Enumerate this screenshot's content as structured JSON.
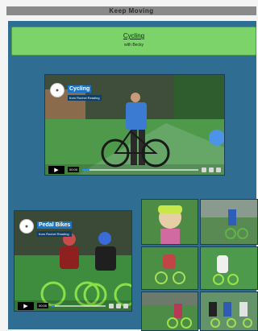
{
  "header": {
    "title": "Keep Moving"
  },
  "banner": {
    "title": "Cycling",
    "subtitle": "with Becky"
  },
  "video_main": {
    "title": "Cycling",
    "subtitle": "from Rochel Reading",
    "time": "00:00"
  },
  "video_pedal": {
    "title": "Pedal Bikes",
    "subtitle": "from Rochel Reading",
    "time": "00:00"
  },
  "colors": {
    "page_bg": "#2f6d93",
    "banner_bg": "#7bd36a",
    "topbar_bg": "#8a8a8a",
    "video_title_bg": "#1b74c6"
  },
  "thumbnails": [
    {
      "name": "photo-1"
    },
    {
      "name": "photo-2"
    },
    {
      "name": "photo-3"
    },
    {
      "name": "photo-4"
    },
    {
      "name": "photo-5"
    },
    {
      "name": "photo-6"
    }
  ]
}
